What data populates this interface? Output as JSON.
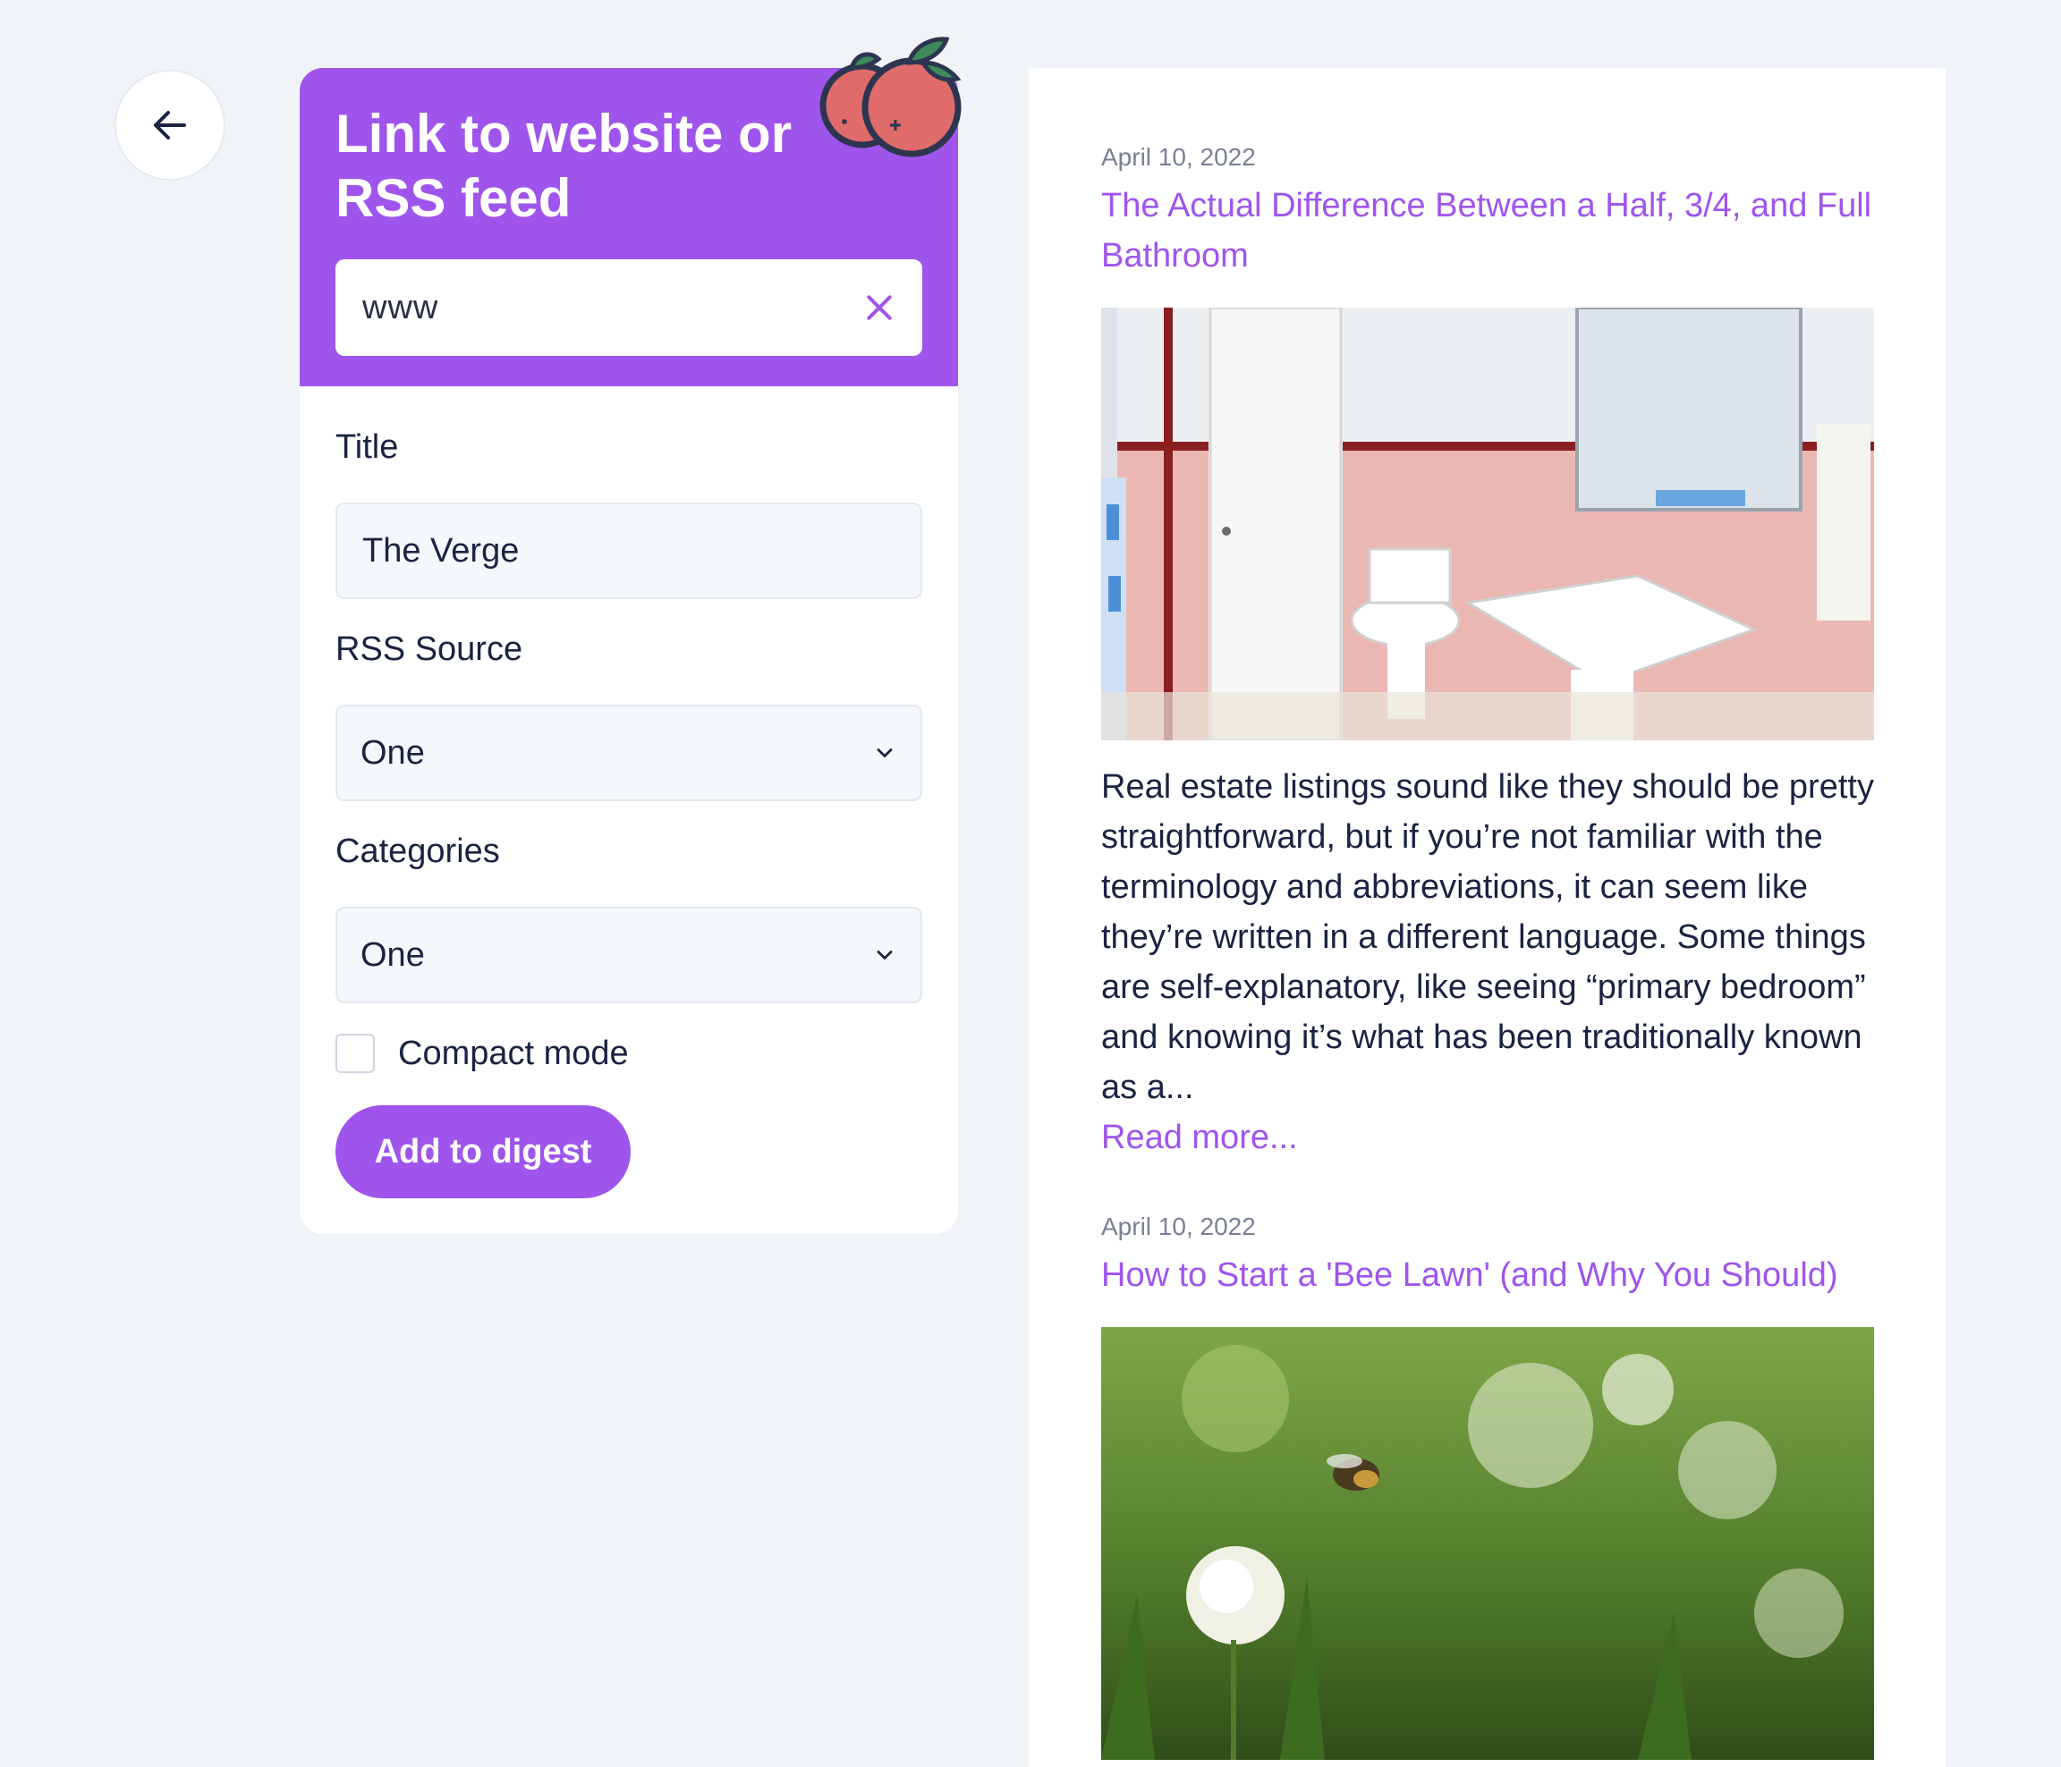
{
  "form": {
    "title": "Link to website or RSS feed",
    "url_value": "www",
    "title_label": "Title",
    "title_value": "The Verge",
    "rss_label": "RSS Source",
    "rss_selected": "One",
    "categories_label": "Categories",
    "categories_selected": "One",
    "compact_label": "Compact mode",
    "compact_checked": false,
    "add_button": "Add to digest"
  },
  "feed": {
    "articles": [
      {
        "date": "April 10, 2022",
        "title": "The Actual Difference Between a Half, 3/4, and Full Bathroom",
        "excerpt": "Real estate listings sound like they should be pretty straightforward, but if you’re not familiar with the terminology and abbreviations, it can seem like they’re written in a different language. Some things are self-explanatory, like seeing “primary bedroom” and knowing it’s what has been traditionally known as a...",
        "read_more": "Read more..."
      },
      {
        "date": "April 10, 2022",
        "title": "How to Start a 'Bee Lawn' (and Why You Should)"
      }
    ]
  },
  "colors": {
    "accent": "#9f55ec",
    "background": "#f0f3f8",
    "text": "#1b2342"
  },
  "icons": {
    "back": "arrow-left-icon",
    "clear": "close-icon",
    "select": "chevron-down-icon",
    "decoration": "berries-icon"
  }
}
